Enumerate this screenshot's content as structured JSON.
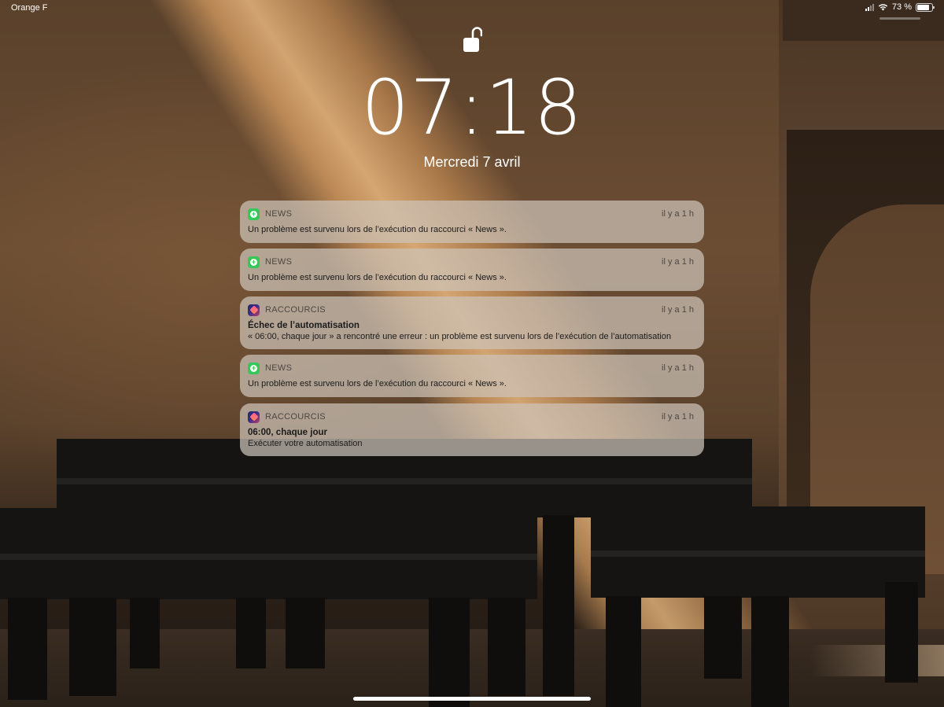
{
  "status_bar": {
    "carrier": "Orange F",
    "battery_percent": "73 %",
    "battery_level": 0.73,
    "signal_icon": "cellular-signal-icon",
    "wifi_icon": "wifi-icon",
    "battery_icon": "battery-icon"
  },
  "lock_screen": {
    "lock_icon": "unlocked-padlock-icon",
    "time": "07:18",
    "date": "Mercredi 7 avril"
  },
  "notifications": [
    {
      "app": "NEWS",
      "icon": "news-app-icon",
      "time": "il y a 1 h",
      "title": "",
      "body": "Un problème est survenu lors de l’exécution du raccourci « News »."
    },
    {
      "app": "NEWS",
      "icon": "news-app-icon",
      "time": "il y a 1 h",
      "title": "",
      "body": "Un problème est survenu lors de l’exécution du raccourci « News »."
    },
    {
      "app": "RACCOURCIS",
      "icon": "shortcuts-app-icon",
      "time": "il y a 1 h",
      "title": "Échec de l’automatisation",
      "body": "« 06:00, chaque jour » a rencontré une erreur : un problème est survenu lors de l’exécution de l’automatisation"
    },
    {
      "app": "NEWS",
      "icon": "news-app-icon",
      "time": "il y a 1 h",
      "title": "",
      "body": "Un problème est survenu lors de l’exécution du raccourci « News »."
    },
    {
      "app": "RACCOURCIS",
      "icon": "shortcuts-app-icon",
      "time": "il y a 1 h",
      "title": "06:00, chaque jour",
      "body": "Exécuter votre automatisation"
    }
  ],
  "colors": {
    "news_icon": "#34c759",
    "notification_bg": "rgba(205,195,185,0.72)",
    "text_on_wallpaper": "#ffffff"
  }
}
